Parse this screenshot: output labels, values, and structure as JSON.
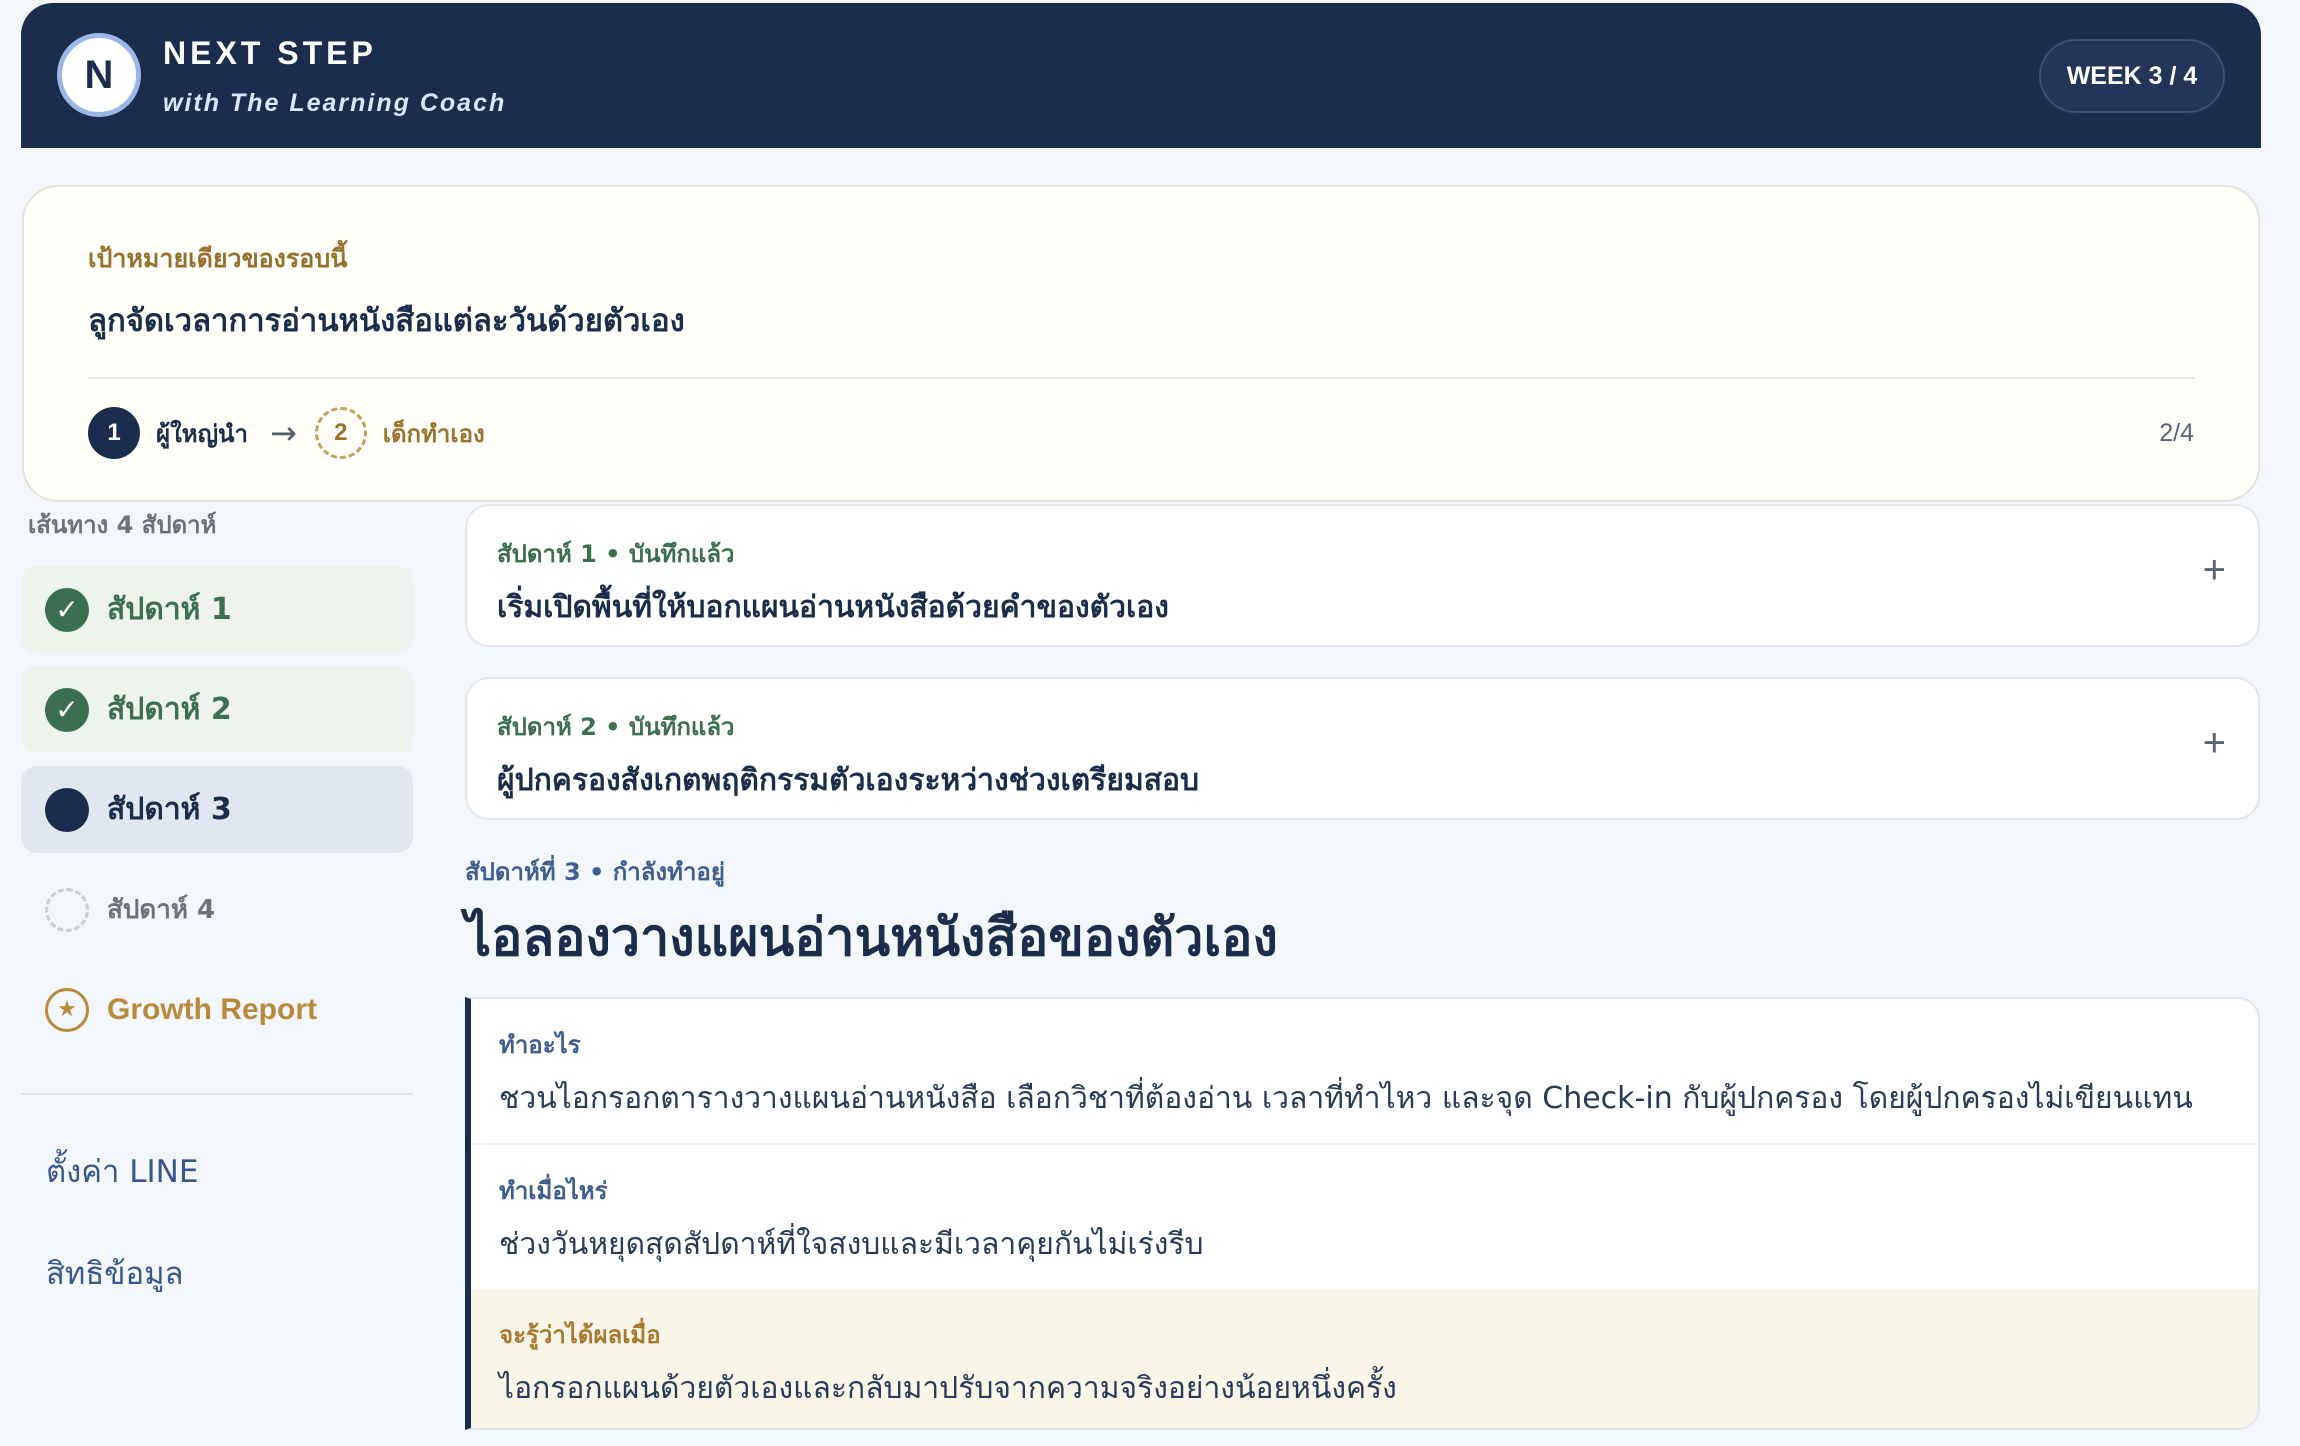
{
  "header": {
    "logo_letter": "N",
    "title": "NEXT STEP",
    "subtitle": "with The Learning Coach",
    "week_badge": "WEEK 3 / 4"
  },
  "goal": {
    "label": "เป้าหมายเดียวของรอบนี้",
    "text": "ลูกจัดเวลาการอ่านหนังสือแต่ละวันด้วยตัวเอง",
    "steps": [
      {
        "number": "1",
        "label": "ผู้ใหญ่นำ",
        "status": "done"
      },
      {
        "number": "2",
        "label": "เด็กทำเอง",
        "status": "pending"
      }
    ],
    "arrow": "→",
    "progress": "2/4"
  },
  "sidebar": {
    "title": "เส้นทาง 4 สัปดาห์",
    "weeks": [
      {
        "label": "สัปดาห์ 1",
        "status": "done",
        "icon": "check-icon",
        "glyph": "✓"
      },
      {
        "label": "สัปดาห์ 2",
        "status": "done",
        "icon": "check-icon",
        "glyph": "✓"
      },
      {
        "label": "สัปดาห์ 3",
        "status": "active",
        "icon": "filled-circle-icon",
        "glyph": ""
      },
      {
        "label": "สัปดาห์ 4",
        "status": "future",
        "icon": "dashed-circle-icon",
        "glyph": ""
      }
    ],
    "report": {
      "label": "Growth Report",
      "icon": "star-icon",
      "glyph": "★"
    },
    "links": [
      "ตั้งค่า LINE",
      "สิทธิข้อมูล"
    ]
  },
  "records": [
    {
      "meta": "สัปดาห์ 1 • บันทึกแล้ว",
      "title": "เริ่มเปิดพื้นที่ให้บอกแผนอ่านหนังสือด้วยคำของตัวเอง",
      "toggle": "+"
    },
    {
      "meta": "สัปดาห์ 2 • บันทึกแล้ว",
      "title": "ผู้ปกครองสังเกตพฤติกรรมตัวเองระหว่างช่วงเตรียมสอบ",
      "toggle": "+"
    }
  ],
  "current": {
    "meta": "สัปดาห์ที่ 3 • กำลังทำอยู่",
    "title": "ไอลองวางแผนอ่านหนังสือของตัวเอง",
    "sections": [
      {
        "label": "ทำอะไร",
        "text": "ชวนไอกรอกตารางวางแผนอ่านหนังสือ เลือกวิชาที่ต้องอ่าน เวลาที่ทำไหว และจุด Check-in กับผู้ปกครอง โดยผู้ปกครองไม่เขียนแทน"
      },
      {
        "label": "ทำเมื่อไหร่",
        "text": "ช่วงวันหยุดสุดสัปดาห์ที่ใจสงบและมีเวลาคุยกันไม่เร่งรีบ"
      },
      {
        "label": "จะรู้ว่าได้ผลเมื่อ",
        "text": "ไอกรอกแผนด้วยตัวเองและกลับมาปรับจากความจริงอย่างน้อยหนึ่งครั้ง"
      }
    ]
  },
  "colors": {
    "navy": "#1b2d4d",
    "green": "#3c6e50",
    "gold": "#b88a3c",
    "link_blue": "#35578a"
  }
}
